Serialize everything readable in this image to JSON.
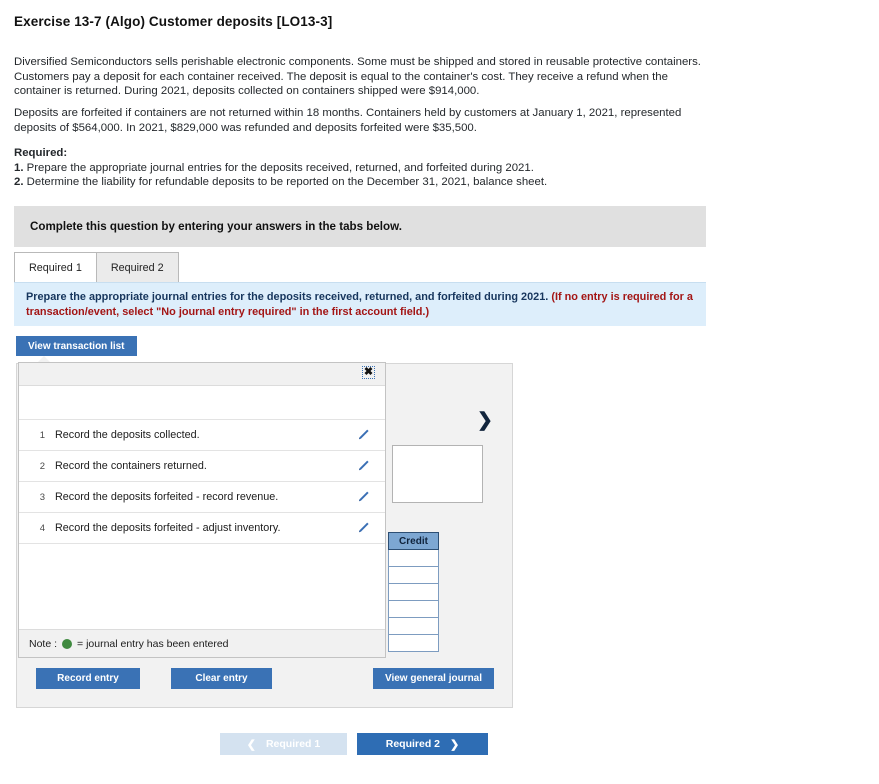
{
  "exercise": {
    "title": "Exercise 13-7 (Algo) Customer deposits [LO13-3]",
    "paragraph_1": "Diversified Semiconductors sells perishable electronic components. Some must be shipped and stored in reusable protective containers. Customers pay a deposit for each container received. The deposit is equal to the container's cost. They receive a refund when the container is returned. During 2021, deposits collected on containers shipped were $914,000.",
    "paragraph_2": "Deposits are forfeited if containers are not returned within 18 months. Containers held by customers at January 1, 2021, represented deposits of $564,000. In 2021, $829,000 was refunded and deposits forfeited were $35,500.",
    "required_heading": "Required:",
    "required_1_num": "1.",
    "required_1_text": " Prepare the appropriate journal entries for the deposits received,  returned, and forfeited during 2021.",
    "required_2_num": "2.",
    "required_2_text": " Determine the liability for refundable deposits to be reported on the December 31, 2021, balance sheet."
  },
  "complete_banner": {
    "text": "Complete this question by entering your answers in the tabs below."
  },
  "tabs": [
    {
      "label": "Required 1",
      "active": true
    },
    {
      "label": "Required 2",
      "active": false
    }
  ],
  "instruction": {
    "line_main": "Prepare the appropriate journal entries for the deposits received,  returned, and forfeited during 2021. ",
    "line_paren": "(If no entry is required for a transaction/event, select \"No journal entry required\" in the first account field.)"
  },
  "view_transaction_list_button": {
    "label": "View transaction list"
  },
  "transaction_popup": {
    "close_icon": "✖",
    "rows": [
      {
        "num": "1",
        "label": "Record the deposits collected."
      },
      {
        "num": "2",
        "label": "Record the containers returned."
      },
      {
        "num": "3",
        "label": "Record the deposits forfeited - record revenue."
      },
      {
        "num": "4",
        "label": "Record the deposits forfeited - adjust inventory."
      }
    ],
    "note_prefix": "Note :",
    "note_text": "= journal entry has been entered",
    "note_dot_color": "#3f8a3f"
  },
  "journal_panel": {
    "chevron": "❯",
    "credit_header": "Credit",
    "credit_row_count": 6
  },
  "action_buttons": {
    "record_entry": "Record entry",
    "clear_entry": "Clear entry",
    "view_general_journal": "View general journal"
  },
  "bottom_nav": {
    "prev_label": "Required 1",
    "prev_arrow": "❮",
    "next_label": "Required 2",
    "next_arrow": "❯"
  },
  "colors": {
    "primary_blue": "#3a72b5",
    "nav_blue": "#2e6db4",
    "nav_disabled": "#d4e2f0",
    "instruction_bg": "#ddeefb",
    "instruction_text": "#17365d",
    "instruction_paren": "#a31515",
    "banner_gray": "#e0e0e0",
    "panel_gray": "#f2f2f2",
    "credit_header_bg": "#7da7d2",
    "note_green": "#3f8a3f"
  }
}
